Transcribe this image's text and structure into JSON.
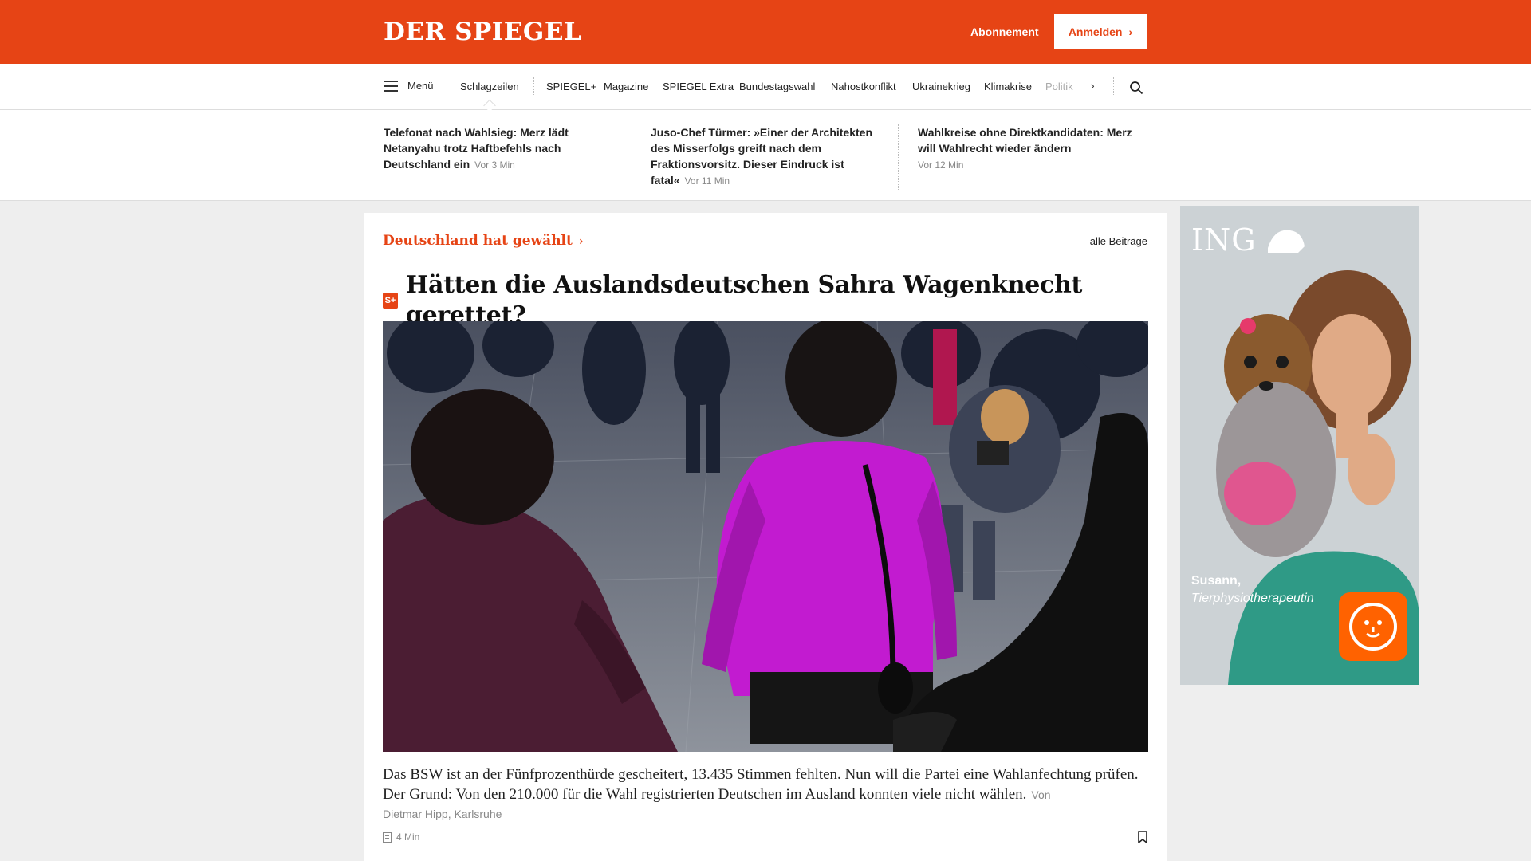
{
  "header": {
    "logo": "DER SPIEGEL",
    "subscription_link": "Abonnement",
    "login_button": "Anmelden",
    "brand_color": "#e64415"
  },
  "nav": {
    "menu_label": "Menü",
    "items": [
      {
        "label": "Schlagzeilen",
        "active": true
      },
      {
        "label": "SPIEGEL+"
      },
      {
        "label": "Magazine"
      },
      {
        "label": "SPIEGEL Extra"
      },
      {
        "label": "Bundestagswahl"
      },
      {
        "label": "Nahostkonflikt"
      },
      {
        "label": "Ukrainekrieg"
      },
      {
        "label": "Klimakrise"
      },
      {
        "label": "Politik"
      }
    ],
    "more_icon": "chevron-right-icon",
    "search_icon": "search-icon"
  },
  "ticker": [
    {
      "headline": "Telefonat nach Wahlsieg: Merz lädt Netanyahu trotz Haftbefehls nach Deutschland ein",
      "time": "Vor 3 Min"
    },
    {
      "headline": "Juso-Chef Türmer: »Einer der Architekten des Misserfolgs greift nach dem Fraktionsvorsitz. Dieser Eindruck ist fatal«",
      "time": "Vor 11 Min"
    },
    {
      "headline": "Wahlkreise ohne Direktkandidaten: Merz will Wahlrecht wieder ändern",
      "time": "Vor 12 Min"
    }
  ],
  "article": {
    "kicker": "Deutschland hat gewählt",
    "all_posts": "alle Beiträge",
    "plus_badge": "S+",
    "headline": "Hätten die Auslandsdeutschen Sahra Wagenknecht gerettet?",
    "teaser": "Das BSW ist an der Fünfprozenthürde gescheitert, 13.435 Stimmen fehlten. Nun will die Partei eine Wahlanfechtung prüfen. Der Grund: Von den 210.000 für die Wahl registrierten Deutschen im Ausland konnten viele nicht wählen.",
    "author_prefix": "Von",
    "author": "Dietmar Hipp, Karlsruhe",
    "reading_time": "4 Min"
  },
  "ad": {
    "brand": "ING",
    "person_name": "Susann,",
    "person_job": "Tierphysiotherapeutin",
    "brand_color": "#ff6200"
  }
}
